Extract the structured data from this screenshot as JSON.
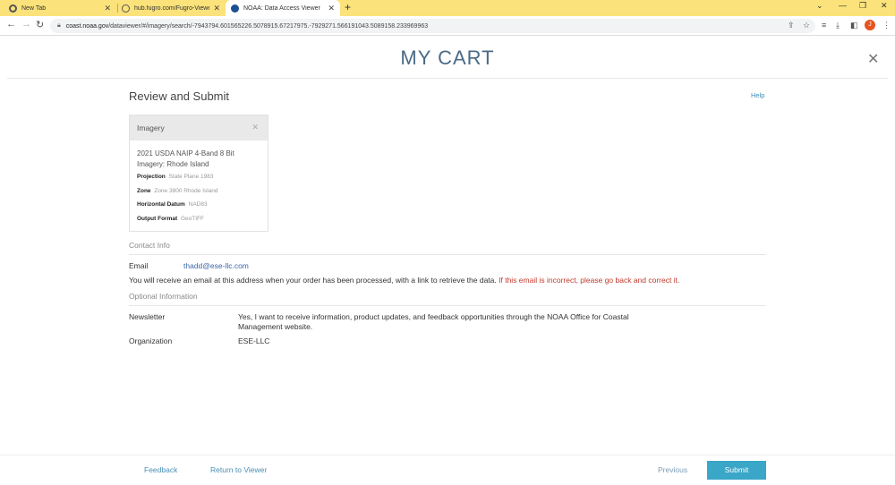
{
  "browser": {
    "tabs": [
      {
        "label": "New Tab"
      },
      {
        "label": "hub.fugro.com/Fugro-Viewer/"
      },
      {
        "label": "NOAA: Data Access Viewer"
      }
    ],
    "url_host": "coast.noaa.gov",
    "url_path": "/dataviewer/#/imagery/search/-7943794.601565226.5078915.67217975.-7929271.566191043.5089158.233969963",
    "profile_initial": "J"
  },
  "page": {
    "title": "MY CART",
    "section_title": "Review and Submit",
    "help_label": "Help"
  },
  "card": {
    "header": "Imagery",
    "dataset_name": "2021 USDA NAIP 4-Band 8 Bit Imagery: Rhode Island",
    "details": [
      {
        "key": "Projection",
        "value": "State Plane 1983"
      },
      {
        "key": "Zone",
        "value": "Zone 3800 Rhode Island"
      },
      {
        "key": "Horizontal Datum",
        "value": "NAD83"
      },
      {
        "key": "Output Format",
        "value": "GeoTIFF"
      }
    ]
  },
  "contact": {
    "heading": "Contact Info",
    "email_label": "Email",
    "email_value": "thadd@ese-llc.com",
    "note": "You will receive an email at this address when your order has been processed, with a link to retrieve the data.",
    "warning": "If this email is incorrect, please go back and correct it."
  },
  "optional": {
    "heading": "Optional Information",
    "newsletter_label": "Newsletter",
    "newsletter_value": "Yes, I want to receive information, product updates, and feedback opportunities through the NOAA Office for Coastal Management website.",
    "organization_label": "Organization",
    "organization_value": "ESE-LLC"
  },
  "footer": {
    "feedback": "Feedback",
    "return": "Return to Viewer",
    "previous": "Previous",
    "submit": "Submit"
  },
  "colors": {
    "tabbar": "#fbe27a",
    "title": "#4b6a86",
    "link": "#3d8eb9",
    "warning": "#c0392b",
    "submit": "#3aa6c8"
  }
}
